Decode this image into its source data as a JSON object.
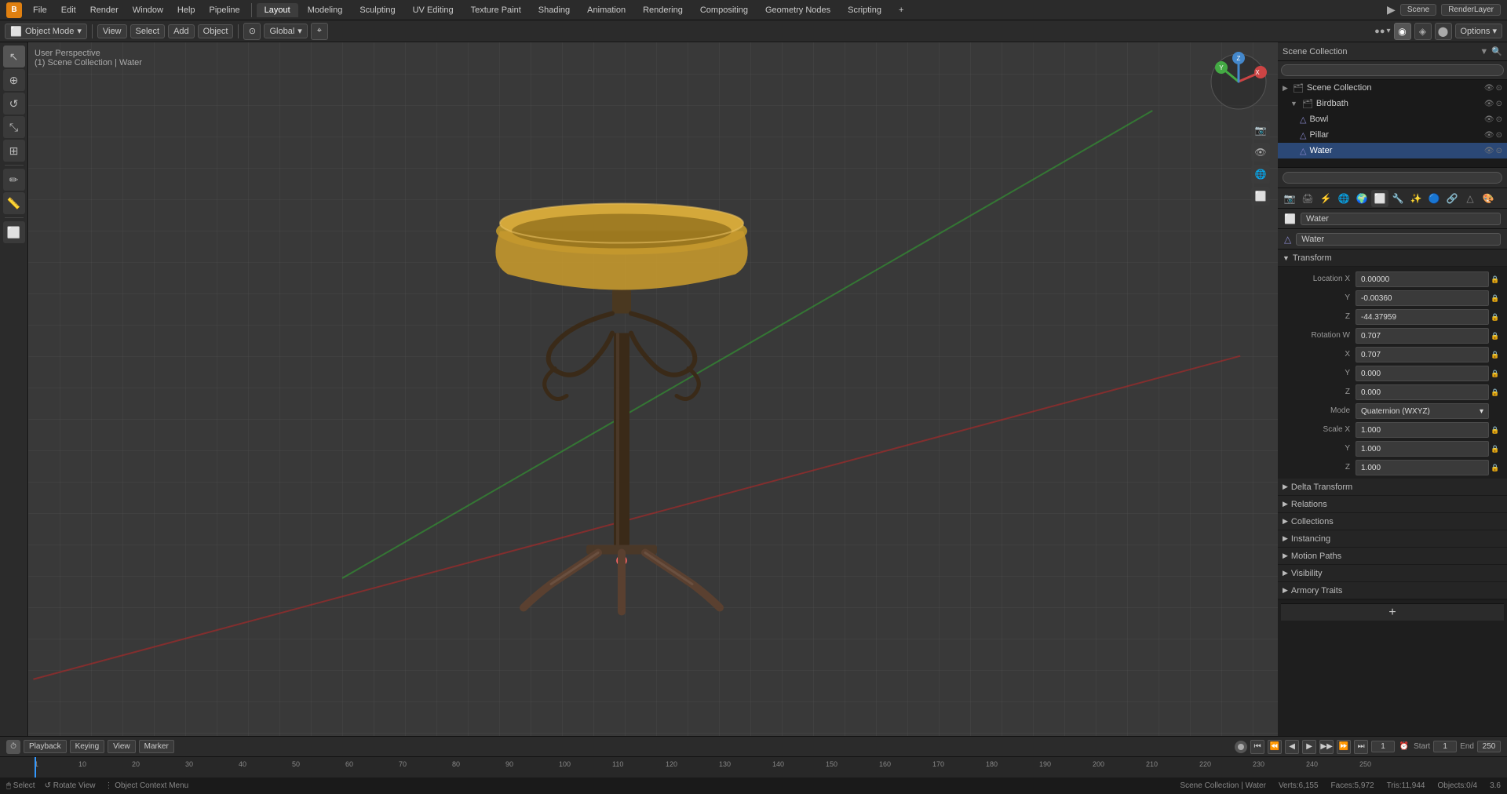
{
  "app": {
    "title": "Blender",
    "workspace": "RenderLayer",
    "scene": "Scene"
  },
  "top_menu": {
    "items": [
      "File",
      "Edit",
      "Render",
      "Window",
      "Help",
      "Pipeline"
    ],
    "tabs": [
      "Layout",
      "Modeling",
      "Sculpting",
      "UV Editing",
      "Texture Paint",
      "Shading",
      "Animation",
      "Rendering",
      "Compositing",
      "Geometry Nodes",
      "Scripting"
    ],
    "active_tab": "Layout",
    "plus_btn": "+"
  },
  "second_toolbar": {
    "mode": "Object Mode",
    "view_label": "View",
    "select_label": "Select",
    "add_label": "Add",
    "object_label": "Object",
    "global_label": "Global",
    "snap_label": "⌖"
  },
  "viewport": {
    "perspective_label": "User Perspective",
    "collection_path": "(1) Scene Collection | Water",
    "grid_floor": true
  },
  "outliner": {
    "header": "Scene Collection",
    "tree": [
      {
        "id": "scene_collection",
        "label": "Scene Collection",
        "level": 0,
        "type": "collection",
        "icon": "🗂"
      },
      {
        "id": "birdbath",
        "label": "Birdbath",
        "level": 1,
        "type": "collection",
        "icon": "🗂",
        "expanded": true
      },
      {
        "id": "bowl",
        "label": "Bowl",
        "level": 2,
        "type": "mesh",
        "icon": "△",
        "selected": false
      },
      {
        "id": "pillar",
        "label": "Pillar",
        "level": 2,
        "type": "mesh",
        "icon": "△",
        "selected": false
      },
      {
        "id": "water",
        "label": "Water",
        "level": 2,
        "type": "mesh",
        "icon": "△",
        "selected": true
      }
    ]
  },
  "properties": {
    "object_name": "Water",
    "data_name": "Water",
    "search_placeholder": "",
    "icons": [
      "📷",
      "⚙",
      "🔧",
      "📐",
      "🔗",
      "👁",
      "🎯",
      "💾",
      "⚡",
      "🌀",
      "🖥",
      "⬜"
    ],
    "active_icon_index": 7,
    "sections": {
      "transform": {
        "label": "Transform",
        "expanded": true,
        "location": {
          "x": "0.00000",
          "y": "-0.00360",
          "z": "-44.37959"
        },
        "rotation": {
          "w": "0.707",
          "x": "0.707",
          "y": "0.000",
          "z": "0.000",
          "mode": "Quaternion (WXYZ)"
        },
        "scale": {
          "x": "1.000",
          "y": "1.000",
          "z": "1.000"
        }
      },
      "delta_transform": {
        "label": "Delta Transform",
        "expanded": false
      },
      "relations": {
        "label": "Relations",
        "expanded": false
      },
      "collections": {
        "label": "Collections",
        "expanded": false
      },
      "instancing": {
        "label": "Instancing",
        "expanded": false
      },
      "motion_paths": {
        "label": "Motion Paths",
        "expanded": false
      },
      "visibility": {
        "label": "Visibility",
        "expanded": false
      },
      "armory_traits": {
        "label": "Armory Traits",
        "expanded": false
      }
    }
  },
  "timeline": {
    "playback_label": "Playback",
    "keying_label": "Keying",
    "view_label": "View",
    "marker_label": "Marker",
    "current_frame": "1",
    "start_frame": "1",
    "end_frame": "250",
    "ruler_marks": [
      "1",
      "10",
      "20",
      "30",
      "40",
      "50",
      "60",
      "70",
      "80",
      "90",
      "100",
      "110",
      "120",
      "130",
      "140",
      "150",
      "160",
      "170",
      "180",
      "190",
      "200",
      "210",
      "220",
      "230",
      "240",
      "250"
    ]
  },
  "status_bar": {
    "collection": "Scene Collection | Water",
    "vertex_count": "Verts:6,155",
    "face_count": "Faces:5,972",
    "tris_count": "Tris:11,944",
    "objects_count": "Objects:0/4",
    "blender_version": "3.6",
    "select_label": "Select",
    "rotate_view_label": "Rotate View",
    "context_menu_label": "Object Context Menu"
  }
}
